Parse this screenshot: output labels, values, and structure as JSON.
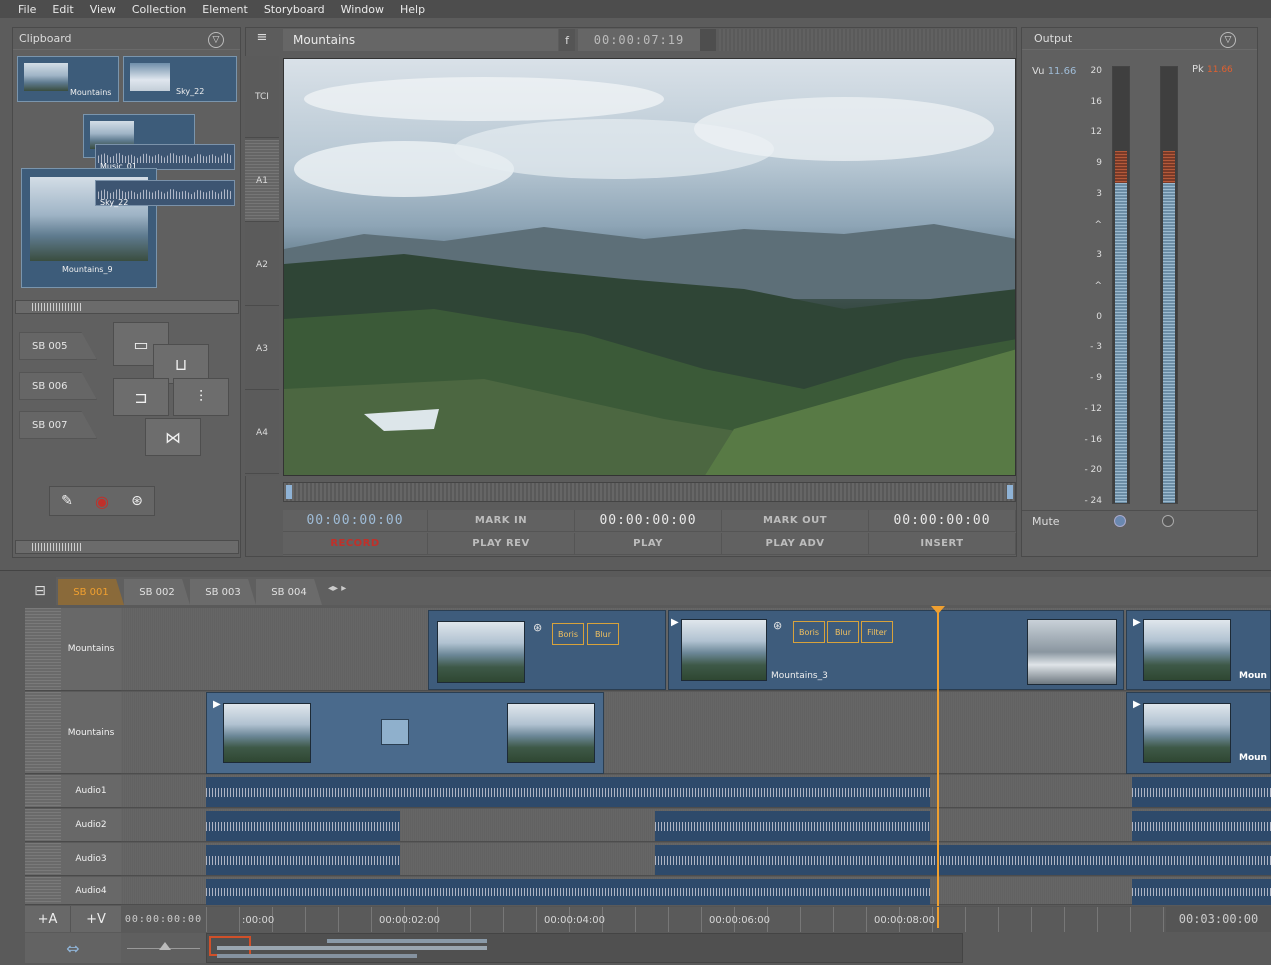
{
  "menu": [
    "File",
    "Edit",
    "View",
    "Collection",
    "Element",
    "Storyboard",
    "Window",
    "Help"
  ],
  "clipboard": {
    "title": "Clipboard",
    "clips": [
      "Mountains",
      "Sky_22",
      "Music_01",
      "Sky_22",
      "Mountains_9"
    ]
  },
  "storyboards": [
    "SB 005",
    "SB 006",
    "SB 007"
  ],
  "preview": {
    "title": "Mountains",
    "f_label": "f",
    "timecode": "00:00:07:19",
    "tracks": [
      "TCI",
      "A1",
      "A2",
      "A3",
      "A4"
    ]
  },
  "controls": {
    "tc_in": "00:00:00:00",
    "mark_in": "MARK IN",
    "tc_mid": "00:00:00:00",
    "mark_out": "MARK OUT",
    "tc_out": "00:00:00:00",
    "record": "RECORD",
    "play_rev": "PLAY REV",
    "play": "PLAY",
    "play_adv": "PLAY ADV",
    "insert": "INSERT"
  },
  "output": {
    "title": "Output",
    "vu_label": "Vu",
    "vu_value": "11.66",
    "pk_label": "Pk",
    "pk_value": "11.66",
    "mute": "Mute",
    "scale": [
      "20",
      "16",
      "12",
      "9",
      "3",
      "^",
      "3",
      "^",
      "0",
      "- 3",
      "- 9",
      "- 12",
      "- 16",
      "- 20",
      "- 24"
    ]
  },
  "timeline": {
    "tabs": [
      "SB 001",
      "SB 002",
      "SB 003",
      "SB 004"
    ],
    "video_rows": [
      "Mountains",
      "Mountains"
    ],
    "audio_rows": [
      "Audio1",
      "Audio2",
      "Audio3",
      "Audio4"
    ],
    "add_audio": "+A",
    "add_video": "+V",
    "start_tc": "00:00:00:00",
    "ruler": [
      ":00:00",
      "00:00:02:00",
      "00:00:04:00",
      "00:00:06:00",
      "00:00:08:00"
    ],
    "total": "00:03:00:00",
    "fx": [
      "Boris",
      "Blur",
      "Boris",
      "Blur",
      "Filter"
    ],
    "clip_names": [
      "Mountains_3",
      "Moun",
      "Moun"
    ]
  },
  "colors": {
    "accent": "#f0a030",
    "clip": "#3e5c7c",
    "record": "#c0302a"
  }
}
